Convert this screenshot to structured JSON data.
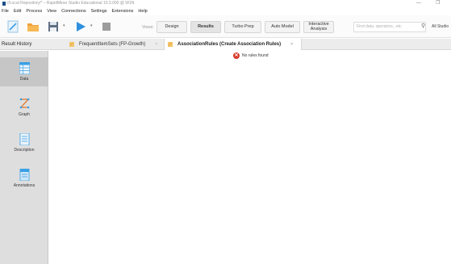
{
  "window": {
    "title": "//Local Repository/* – RapidMiner Studio Educational 10.3.000 @ W1N",
    "minimize": "—",
    "maximize": "❐"
  },
  "menu": [
    "File",
    "Edit",
    "Process",
    "View",
    "Connections",
    "Settings",
    "Extensions",
    "Help"
  ],
  "toolbar": {
    "views_label": "Views:",
    "views": [
      "Design",
      "Results",
      "Turbo Prep",
      "Auto Model",
      "Interactive Analysis"
    ],
    "active_view": "Results",
    "search_placeholder": "Find data, operators...etc",
    "search_scope": "All Studio"
  },
  "tabs": {
    "result_history": "Result History",
    "items": [
      {
        "label": "FrequentItemSets (FP-Growth)",
        "close": "×"
      },
      {
        "label": "AssociationRules (Create Association Rules)",
        "close": "×"
      }
    ],
    "active_index": 1
  },
  "sidebar": {
    "items": [
      {
        "label": "Data",
        "icon": "table-icon"
      },
      {
        "label": "Graph",
        "icon": "graph-icon"
      },
      {
        "label": "Description",
        "icon": "description-icon"
      },
      {
        "label": "Annotations",
        "icon": "annotations-icon"
      }
    ],
    "active_index": 0
  },
  "main": {
    "message": "No rules found",
    "message_icon": "error-icon"
  },
  "colors": {
    "accent_blue": "#3aa0e4",
    "folder_orange": "#f0a23a",
    "play_blue": "#2f8fe0",
    "error_red": "#d63a2b"
  }
}
